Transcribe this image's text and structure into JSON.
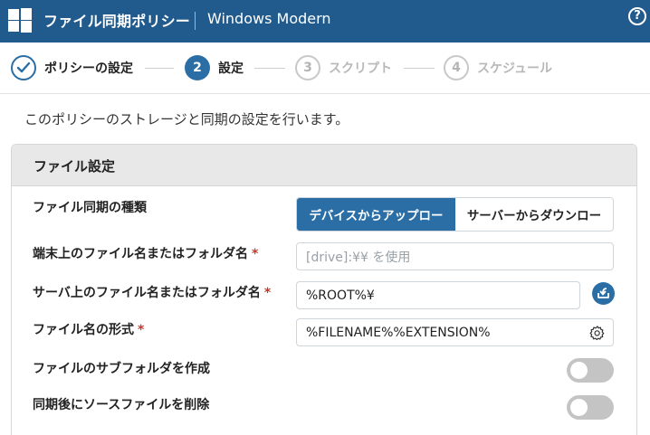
{
  "header": {
    "title": "ファイル同期ポリシー",
    "separator": "|",
    "subtitle": "Windows Modern",
    "help_label": "?"
  },
  "stepper": {
    "steps": [
      {
        "number": "✓",
        "label": "ポリシーの設定",
        "state": "completed"
      },
      {
        "number": "2",
        "label": "設定",
        "state": "active"
      },
      {
        "number": "3",
        "label": "スクリプト",
        "state": "pending"
      },
      {
        "number": "4",
        "label": "スケジュール",
        "state": "pending"
      }
    ]
  },
  "intro": "このポリシーのストレージと同期の設定を行います。",
  "section": {
    "title": "ファイル設定",
    "sync_type": {
      "label": "ファイル同期の種類",
      "options": [
        "デバイスからアップロー",
        "サーバーからダウンロー"
      ],
      "selected": "デバイスからアップロー"
    },
    "device_path": {
      "label": "端末上のファイル名またはフォルダ名",
      "required": "*",
      "value": "",
      "placeholder": "[drive]:¥¥ を使用"
    },
    "server_path": {
      "label": "サーバ上のファイル名またはフォルダ名",
      "required": "*",
      "value": "%ROOT%¥",
      "button_icon": "import-icon"
    },
    "filename_format": {
      "label": "ファイル名の形式",
      "required": "*",
      "value": "%FILENAME%%EXTENSION%",
      "icon": "gear-icon"
    },
    "create_subfolder": {
      "label": "ファイルのサブフォルダを作成",
      "enabled": false
    },
    "delete_source": {
      "label": "同期後にソースファイルを削除",
      "enabled": false
    }
  },
  "colors": {
    "header_bg": "#215a8c",
    "accent": "#2b6ea6",
    "required": "#c0392b",
    "toggle_off": "#c4c4c4"
  }
}
